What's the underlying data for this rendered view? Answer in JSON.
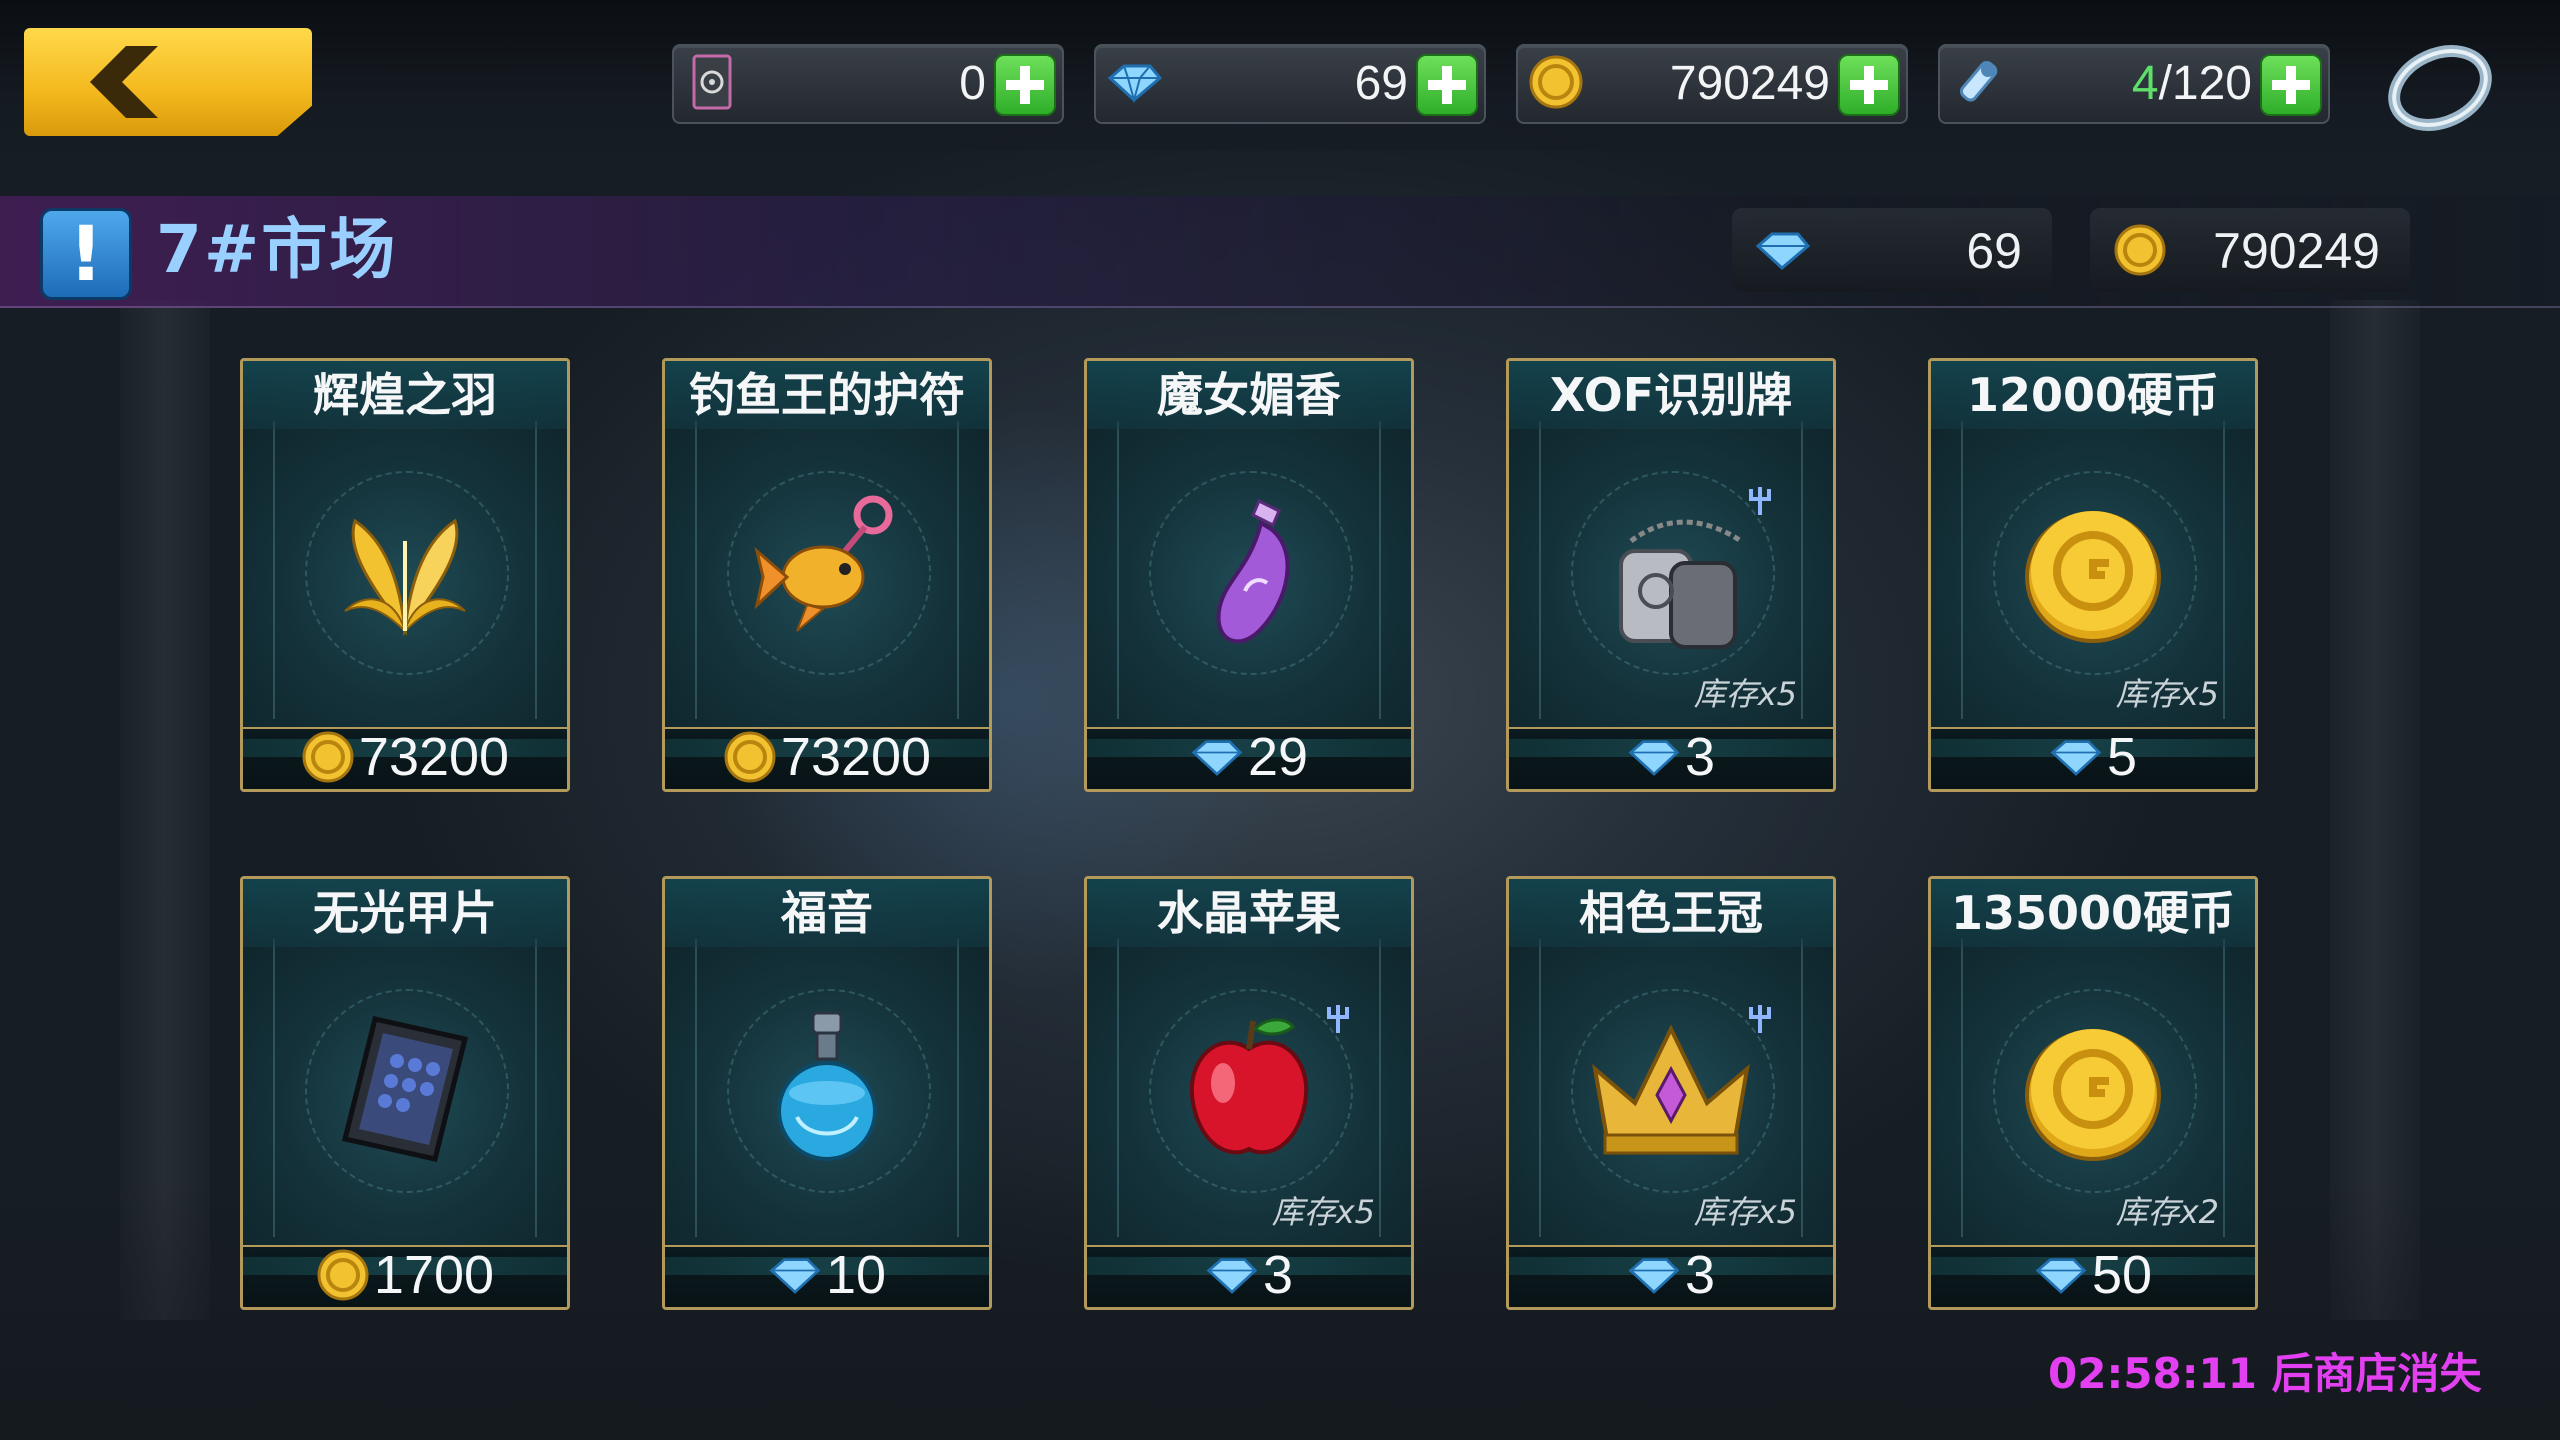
{
  "topbar": {
    "resources": [
      {
        "icon": "badge-icon",
        "value": "0"
      },
      {
        "icon": "gem-icon",
        "value": "69"
      },
      {
        "icon": "gold-coin-icon",
        "value": "790249"
      },
      {
        "icon": "stamina-vial-icon",
        "current": "4",
        "max": "/120"
      }
    ]
  },
  "shop": {
    "title": "7#市场",
    "gems": "69",
    "coins": "790249",
    "timer_text": "02:58:11 后商店消失"
  },
  "items": [
    {
      "name": "辉煌之羽",
      "icon": "golden-feather-icon",
      "currency": "coin",
      "price": "73200",
      "stock": ""
    },
    {
      "name": "钓鱼王的护符",
      "icon": "goldfish-charm-icon",
      "currency": "coin",
      "price": "73200",
      "stock": ""
    },
    {
      "name": "魔女媚香",
      "icon": "perfume-bottle-icon",
      "currency": "gem",
      "price": "29",
      "stock": ""
    },
    {
      "name": "XOF识别牌",
      "icon": "dog-tag-icon",
      "currency": "gem",
      "price": "3",
      "stock": "库存x5"
    },
    {
      "name": "12000硬币",
      "icon": "gold-coin-icon",
      "currency": "gem",
      "price": "5",
      "stock": "库存x5"
    },
    {
      "name": "无光甲片",
      "icon": "armor-plate-icon",
      "currency": "coin",
      "price": "1700",
      "stock": ""
    },
    {
      "name": "福音",
      "icon": "blue-potion-icon",
      "currency": "gem",
      "price": "10",
      "stock": ""
    },
    {
      "name": "水晶苹果",
      "icon": "crystal-apple-icon",
      "currency": "gem",
      "price": "3",
      "stock": "库存x5"
    },
    {
      "name": "相色王冠",
      "icon": "crown-icon",
      "currency": "gem",
      "price": "3",
      "stock": "库存x5"
    },
    {
      "name": "135000硬币",
      "icon": "gold-coin-icon",
      "currency": "gem",
      "price": "50",
      "stock": "库存x2"
    }
  ],
  "colors": {
    "accent": "#f3b81d",
    "timer": "#e240f0",
    "title": "#9ad0ff",
    "plus": "#2fae2a"
  }
}
